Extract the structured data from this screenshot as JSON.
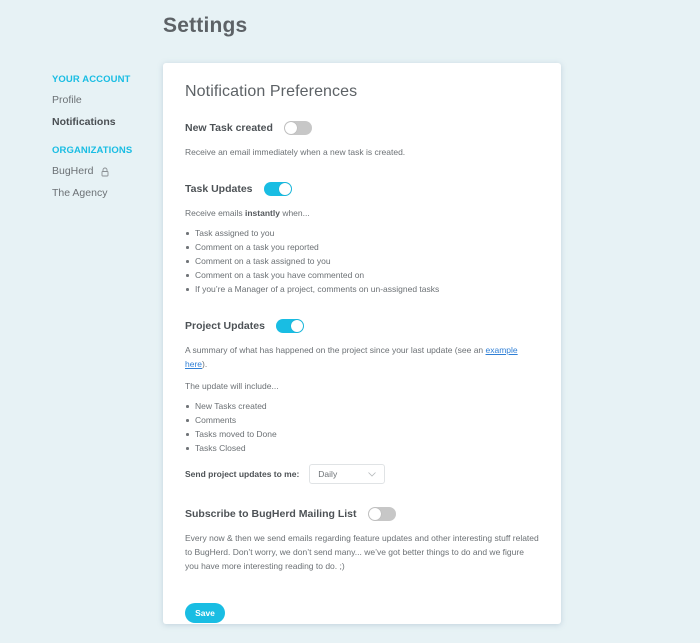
{
  "page": {
    "title": "Settings"
  },
  "colors": {
    "accent": "#19bde3",
    "background": "#e7f2f5",
    "toggle_off": "#c7c7c7",
    "link": "#2f7fd6"
  },
  "sidebar": {
    "account_heading": "YOUR ACCOUNT",
    "account_items": [
      {
        "label": "Profile",
        "active": false
      },
      {
        "label": "Notifications",
        "active": true
      }
    ],
    "org_heading": "ORGANIZATIONS",
    "org_items": [
      {
        "label": "BugHerd",
        "icon": "lock-icon"
      },
      {
        "label": "The Agency"
      }
    ]
  },
  "card": {
    "title": "Notification Preferences",
    "new_task": {
      "label": "New Task created",
      "enabled": false,
      "description": "Receive an email immediately when a new task is created."
    },
    "task_updates": {
      "label": "Task Updates",
      "enabled": true,
      "desc_prefix": "Receive emails ",
      "desc_bold": "instantly",
      "desc_suffix": " when...",
      "items": [
        "Task assigned to you",
        "Comment on a task you reported",
        "Comment on a task assigned to you",
        "Comment on a task you have commented on",
        "If you’re a Manager of a project, comments on un-assigned tasks"
      ]
    },
    "project_updates": {
      "label": "Project Updates",
      "enabled": true,
      "desc_prefix": "A summary of what has happened on the project since your last update (see an ",
      "desc_link": "example here",
      "desc_suffix": ").",
      "include_intro": "The update will include...",
      "items": [
        "New Tasks created",
        "Comments",
        "Tasks moved to Done",
        "Tasks Closed"
      ],
      "frequency_label": "Send project updates to me:",
      "frequency_value": "Daily"
    },
    "mailing_list": {
      "label": "Subscribe to BugHerd Mailing List",
      "enabled": false,
      "description": "Every now & then we send emails regarding feature updates and other interesting stuff related to BugHerd. Don’t worry, we don’t send many... we’ve got better things to do and we figure you have more interesting reading to do. ;)"
    },
    "save_label": "Save"
  }
}
